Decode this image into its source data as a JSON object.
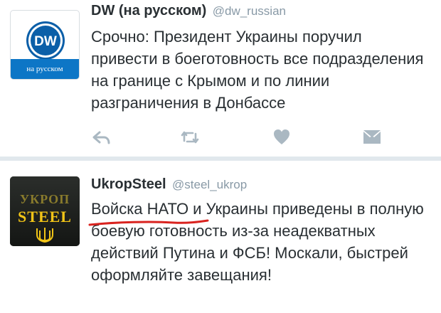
{
  "tweets": [
    {
      "author": "DW (на русском)",
      "handle": "@dw_russian",
      "avatar_label": "на русском",
      "avatar_logo": "DW",
      "text": "Срочно: Президент Украины поручил привести в боеготовность все подразделения на границе с Крымом и по линии разграничения в Донбассе",
      "actions": [
        "reply-icon",
        "retweet-icon",
        "like-icon",
        "direct-message-icon"
      ]
    },
    {
      "author": "UkropSteel",
      "handle": "@steel_ukrop",
      "avatar_top": "УКРОП",
      "avatar_word": "STEEL",
      "text": "Войска НАТО и Украины приведены в полную боевую готовность из-за неадекватных действий Путина и ФСБ! Москали, быстрей оформляйте завещания!"
    }
  ],
  "colors": {
    "action_icon": "#aab8c2",
    "underline": "#d9231f",
    "dw_blue": "#0d76c6",
    "steel_yellow": "#f1c417"
  }
}
